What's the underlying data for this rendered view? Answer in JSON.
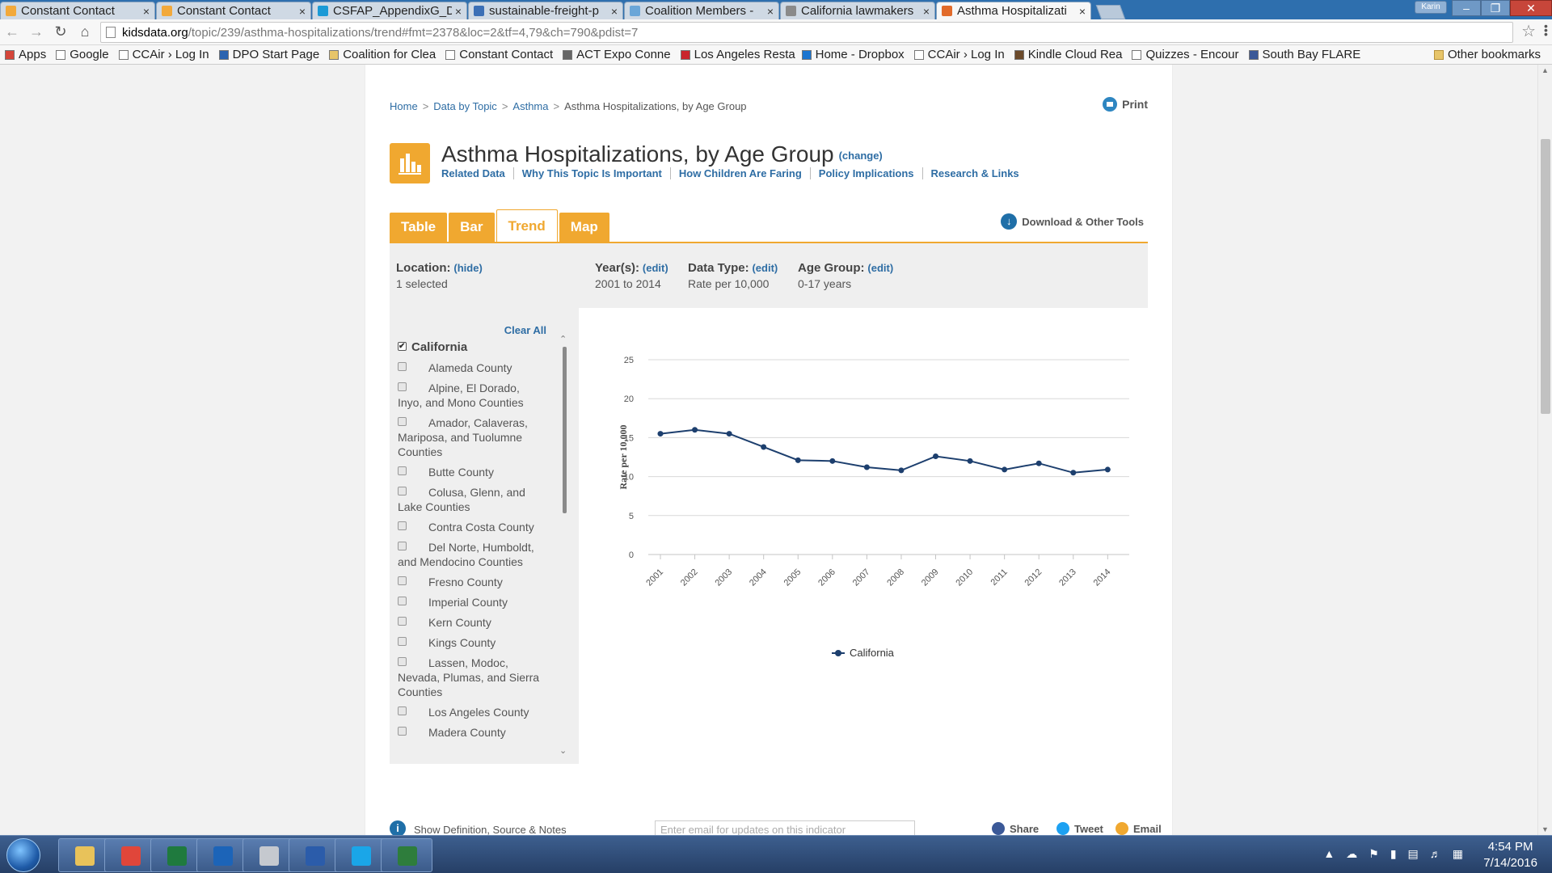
{
  "browser": {
    "tabs": [
      {
        "title": "Constant Contact",
        "color": "#f2a93b"
      },
      {
        "title": "Constant Contact",
        "color": "#f2a93b"
      },
      {
        "title": "CSFAP_AppendixG_D",
        "color": "#1b9ad6"
      },
      {
        "title": "sustainable-freight-p",
        "color": "#3b6fb6"
      },
      {
        "title": "Coalition Members -",
        "color": "#6aa6d8"
      },
      {
        "title": "California lawmakers",
        "color": "#8a8a8a"
      },
      {
        "title": "Asthma Hospitalizati",
        "color": "#e26b2a",
        "active": true
      }
    ],
    "user_label": "Karin",
    "url_host": "kidsdata.org",
    "url_path": "/topic/239/asthma-hospitalizations/trend#fmt=2378&loc=2&tf=4,79&ch=790&pdist=7",
    "bookmarks": [
      {
        "label": "Apps",
        "icon": "apps-grid-icon"
      },
      {
        "label": "Google",
        "icon": "page-icon"
      },
      {
        "label": "CCAir › Log In",
        "icon": "page-icon"
      },
      {
        "label": "DPO Start Page",
        "icon": "globe-icon"
      },
      {
        "label": "Coalition for Clea",
        "icon": "folder-icon"
      },
      {
        "label": "Constant Contact",
        "icon": "page-icon"
      },
      {
        "label": "ACT Expo Conne",
        "icon": "link-icon"
      },
      {
        "label": "Los Angeles Resta",
        "icon": "yelp-icon"
      },
      {
        "label": "Home - Dropbox",
        "icon": "dropbox-icon"
      },
      {
        "label": "CCAir › Log In",
        "icon": "page-icon"
      },
      {
        "label": "Kindle Cloud Rea",
        "icon": "kindle-icon"
      },
      {
        "label": "Quizzes - Encour",
        "icon": "page-icon"
      },
      {
        "label": "South Bay FLARE",
        "icon": "facebook-icon"
      }
    ],
    "other_bookmarks": "Other bookmarks"
  },
  "page": {
    "breadcrumb": [
      "Home",
      "Data by Topic",
      "Asthma",
      "Asthma Hospitalizations, by Age Group"
    ],
    "print_label": "Print",
    "title": "Asthma Hospitalizations, by Age Group",
    "change_label": "(change)",
    "sublinks": [
      "Related Data",
      "Why This Topic Is Important",
      "How Children Are Faring",
      "Policy Implications",
      "Research & Links"
    ],
    "view_tabs": [
      "Table",
      "Bar",
      "Trend",
      "Map"
    ],
    "active_tab": "Trend",
    "download_label": "Download & Other Tools",
    "filters": {
      "location": {
        "label": "Location:",
        "action": "(hide)",
        "value": "1 selected"
      },
      "years": {
        "label": "Year(s):",
        "action": "(edit)",
        "value": "2001 to 2014"
      },
      "data_type": {
        "label": "Data Type:",
        "action": "(edit)",
        "value": "Rate per 10,000"
      },
      "age_group": {
        "label": "Age Group:",
        "action": "(edit)",
        "value": "0-17 years"
      }
    },
    "clear_all": "Clear All",
    "locations": [
      {
        "name": "California",
        "checked": true,
        "state": true
      },
      {
        "name": "Alameda County"
      },
      {
        "name": "Alpine, El Dorado, Inyo, and Mono Counties"
      },
      {
        "name": "Amador, Calaveras, Mariposa, and Tuolumne Counties"
      },
      {
        "name": "Butte County"
      },
      {
        "name": "Colusa, Glenn, and Lake Counties"
      },
      {
        "name": "Contra Costa County"
      },
      {
        "name": "Del Norte, Humboldt, and Mendocino Counties"
      },
      {
        "name": "Fresno County"
      },
      {
        "name": "Imperial County"
      },
      {
        "name": "Kern County"
      },
      {
        "name": "Kings County"
      },
      {
        "name": "Lassen, Modoc, Nevada, Plumas, and Sierra Counties"
      },
      {
        "name": "Los Angeles County"
      },
      {
        "name": "Madera County"
      }
    ],
    "footer": {
      "show_definition": "Show Definition, Source & Notes",
      "email_placeholder": "Enter email for updates on this indicator",
      "share": "Share",
      "tweet": "Tweet",
      "email": "Email"
    }
  },
  "chart_data": {
    "type": "line",
    "title": "",
    "xlabel": "",
    "ylabel": "Rate per 10,000",
    "ylim": [
      0,
      25
    ],
    "yticks": [
      0,
      5,
      10,
      15,
      20,
      25
    ],
    "grid": true,
    "legend_position": "bottom",
    "categories": [
      "2001",
      "2002",
      "2003",
      "2004",
      "2005",
      "2006",
      "2007",
      "2008",
      "2009",
      "2010",
      "2011",
      "2012",
      "2013",
      "2014"
    ],
    "series": [
      {
        "name": "California",
        "color": "#1d3f6e",
        "values": [
          15.5,
          16.0,
          15.5,
          13.8,
          12.1,
          12.0,
          11.2,
          10.8,
          12.6,
          12.0,
          10.9,
          11.7,
          10.5,
          10.9
        ]
      }
    ]
  },
  "taskbar": {
    "apps": [
      {
        "name": "explorer",
        "color": "#e8c25a"
      },
      {
        "name": "chrome",
        "color": "#e0463a"
      },
      {
        "name": "excel",
        "color": "#1f7a3e"
      },
      {
        "name": "outlook",
        "color": "#1c64b8"
      },
      {
        "name": "calculator",
        "color": "#c5c9cf"
      },
      {
        "name": "word",
        "color": "#2b5caa"
      },
      {
        "name": "skype",
        "color": "#1aa6e8"
      },
      {
        "name": "remote",
        "color": "#2e7d3c"
      }
    ],
    "time": "4:54 PM",
    "date": "7/14/2016"
  }
}
